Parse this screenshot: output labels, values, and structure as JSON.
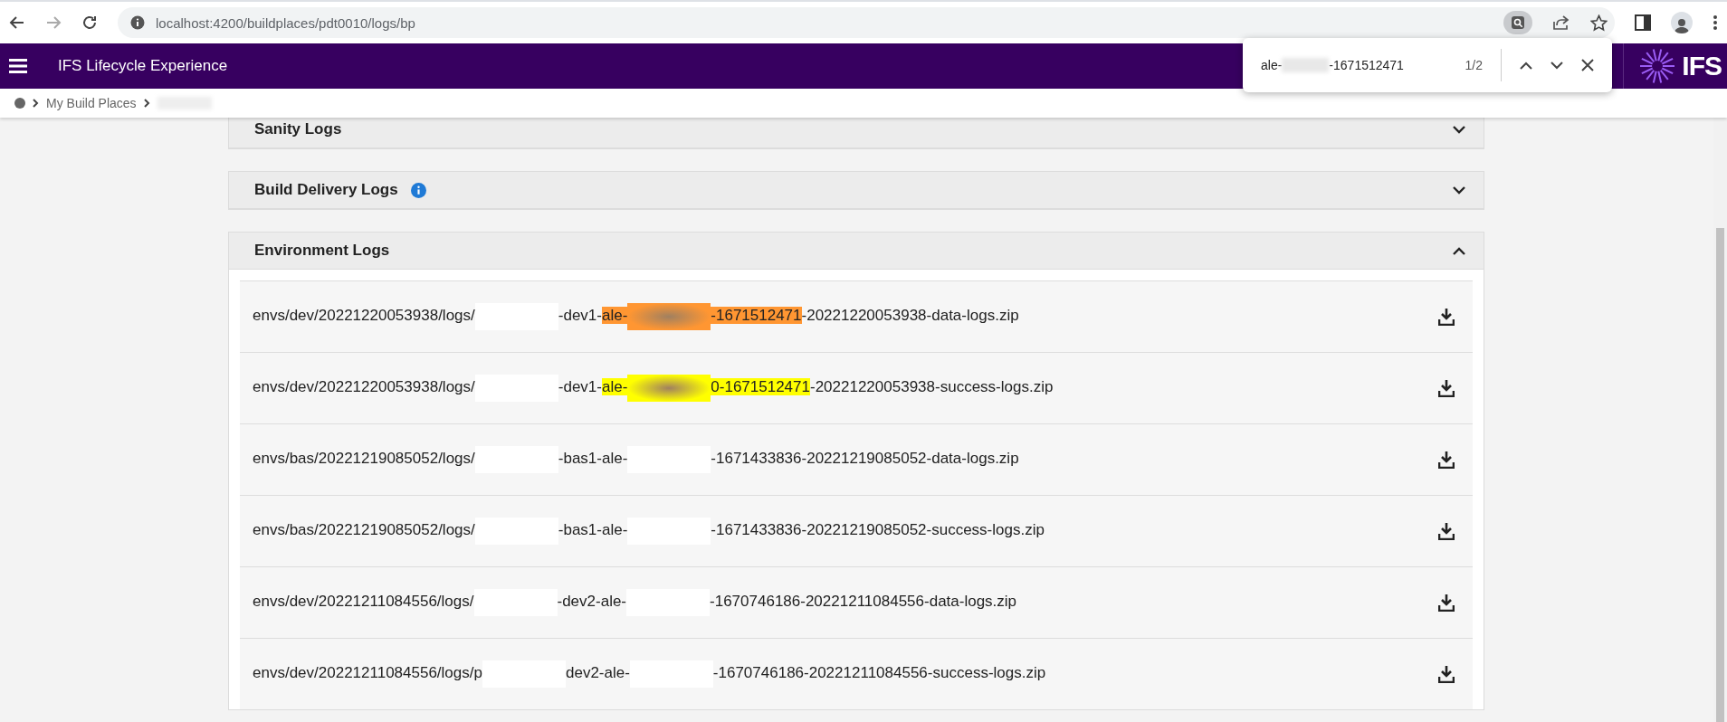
{
  "browser": {
    "url": "localhost:4200/buildplaces/pdt0010/logs/bp"
  },
  "header": {
    "title": "IFS Lifecycle Experience",
    "logo": "IFS"
  },
  "breadcrumb": [
    {
      "kind": "home"
    },
    {
      "kind": "link",
      "label": "My Build Places"
    },
    {
      "kind": "redacted"
    }
  ],
  "find_bar": {
    "query": [
      {
        "kind": "text",
        "text": "ale-"
      },
      {
        "kind": "redacted"
      },
      {
        "kind": "text",
        "text": "-1671512471"
      }
    ],
    "count": "1/2"
  },
  "sections": [
    {
      "title": "Sanity Logs",
      "expanded": false,
      "info": false
    },
    {
      "title": "Build Delivery Logs",
      "expanded": false,
      "info": true
    },
    {
      "title": "Environment Logs",
      "expanded": true,
      "info": false,
      "files": [
        {
          "segments": [
            {
              "kind": "text",
              "text": "envs/dev/20221220053938/logs/",
              "highlighted": false,
              "current": false
            },
            {
              "kind": "redacted",
              "highlighted": false,
              "current": false
            },
            {
              "kind": "text",
              "text": "-dev1-",
              "highlighted": false,
              "current": false
            },
            {
              "kind": "text",
              "text": "ale-",
              "highlighted": true,
              "current": true
            },
            {
              "kind": "redacted",
              "highlighted": true,
              "current": true
            },
            {
              "kind": "text",
              "text": "-1671512471",
              "highlighted": true,
              "current": true
            },
            {
              "kind": "text",
              "text": "-20221220053938-data-logs.zip",
              "highlighted": false,
              "current": false
            }
          ]
        },
        {
          "segments": [
            {
              "kind": "text",
              "text": "envs/dev/20221220053938/logs/",
              "highlighted": false,
              "current": false
            },
            {
              "kind": "redacted",
              "highlighted": false,
              "current": false
            },
            {
              "kind": "text",
              "text": "-dev1-",
              "highlighted": false,
              "current": false
            },
            {
              "kind": "text",
              "text": "ale-",
              "highlighted": true,
              "current": false
            },
            {
              "kind": "redacted",
              "highlighted": true,
              "current": false
            },
            {
              "kind": "text",
              "text": "0-1671512471",
              "highlighted": true,
              "current": false
            },
            {
              "kind": "text",
              "text": "-20221220053938-success-logs.zip",
              "highlighted": false,
              "current": false
            }
          ]
        },
        {
          "segments": [
            {
              "kind": "text",
              "text": "envs/bas/20221219085052/logs/",
              "highlighted": false,
              "current": false
            },
            {
              "kind": "redacted",
              "highlighted": false,
              "current": false
            },
            {
              "kind": "text",
              "text": "-bas1-ale-",
              "highlighted": false,
              "current": false
            },
            {
              "kind": "redacted",
              "highlighted": false,
              "current": false
            },
            {
              "kind": "text",
              "text": "-1671433836-20221219085052-data-logs.zip",
              "highlighted": false,
              "current": false
            }
          ]
        },
        {
          "segments": [
            {
              "kind": "text",
              "text": "envs/bas/20221219085052/logs/",
              "highlighted": false,
              "current": false
            },
            {
              "kind": "redacted",
              "highlighted": false,
              "current": false
            },
            {
              "kind": "text",
              "text": "-bas1-ale-",
              "highlighted": false,
              "current": false
            },
            {
              "kind": "redacted",
              "highlighted": false,
              "current": false
            },
            {
              "kind": "text",
              "text": "-1671433836-20221219085052-success-logs.zip",
              "highlighted": false,
              "current": false
            }
          ]
        },
        {
          "segments": [
            {
              "kind": "text",
              "text": "envs/dev/20221211084556/logs/",
              "highlighted": false,
              "current": false
            },
            {
              "kind": "redacted",
              "highlighted": false,
              "current": false
            },
            {
              "kind": "text",
              "text": "-dev2-ale-",
              "highlighted": false,
              "current": false
            },
            {
              "kind": "redacted",
              "highlighted": false,
              "current": false
            },
            {
              "kind": "text",
              "text": "-1670746186-20221211084556-data-logs.zip",
              "highlighted": false,
              "current": false
            }
          ]
        },
        {
          "segments": [
            {
              "kind": "text",
              "text": "envs/dev/20221211084556/logs/p",
              "highlighted": false,
              "current": false
            },
            {
              "kind": "redacted",
              "highlighted": false,
              "current": false
            },
            {
              "kind": "text",
              "text": "dev2-ale-",
              "highlighted": false,
              "current": false
            },
            {
              "kind": "redacted",
              "highlighted": false,
              "current": false
            },
            {
              "kind": "text",
              "text": "-1670746186-20221211084556-success-logs.zip",
              "highlighted": false,
              "current": false
            }
          ]
        }
      ]
    }
  ]
}
